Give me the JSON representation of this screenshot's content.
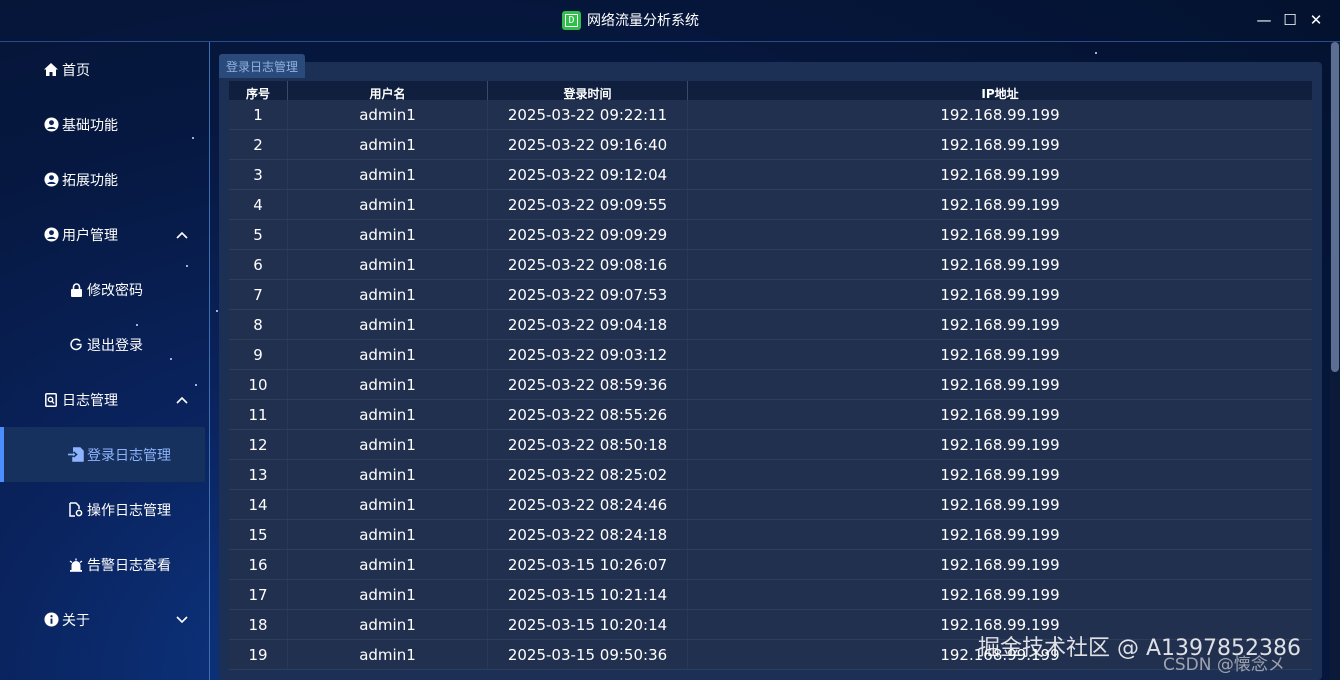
{
  "window": {
    "title": "网络流量分析系统",
    "minimize": "—",
    "maximize": "☐",
    "close": "✕"
  },
  "sidebar": {
    "items": [
      {
        "label": "首页",
        "icon": "home-icon"
      },
      {
        "label": "基础功能",
        "icon": "user-circle-icon"
      },
      {
        "label": "拓展功能",
        "icon": "user-circle-icon"
      },
      {
        "label": "用户管理",
        "icon": "user-circle-icon"
      },
      {
        "label": "修改密码",
        "icon": "lock-icon"
      },
      {
        "label": "退出登录",
        "icon": "logout-icon"
      },
      {
        "label": "日志管理",
        "icon": "log-icon"
      },
      {
        "label": "登录日志管理",
        "icon": "login-file-icon"
      },
      {
        "label": "操作日志管理",
        "icon": "operation-file-icon"
      },
      {
        "label": "告警日志查看",
        "icon": "alarm-icon"
      },
      {
        "label": "关于",
        "icon": "info-icon"
      }
    ]
  },
  "tab": {
    "label": "登录日志管理"
  },
  "table": {
    "headers": [
      "序号",
      "用户名",
      "登录时间",
      "IP地址"
    ],
    "rows": [
      [
        "1",
        "admin1",
        "2025-03-22 09:22:11",
        "192.168.99.199"
      ],
      [
        "2",
        "admin1",
        "2025-03-22 09:16:40",
        "192.168.99.199"
      ],
      [
        "3",
        "admin1",
        "2025-03-22 09:12:04",
        "192.168.99.199"
      ],
      [
        "4",
        "admin1",
        "2025-03-22 09:09:55",
        "192.168.99.199"
      ],
      [
        "5",
        "admin1",
        "2025-03-22 09:09:29",
        "192.168.99.199"
      ],
      [
        "6",
        "admin1",
        "2025-03-22 09:08:16",
        "192.168.99.199"
      ],
      [
        "7",
        "admin1",
        "2025-03-22 09:07:53",
        "192.168.99.199"
      ],
      [
        "8",
        "admin1",
        "2025-03-22 09:04:18",
        "192.168.99.199"
      ],
      [
        "9",
        "admin1",
        "2025-03-22 09:03:12",
        "192.168.99.199"
      ],
      [
        "10",
        "admin1",
        "2025-03-22 08:59:36",
        "192.168.99.199"
      ],
      [
        "11",
        "admin1",
        "2025-03-22 08:55:26",
        "192.168.99.199"
      ],
      [
        "12",
        "admin1",
        "2025-03-22 08:50:18",
        "192.168.99.199"
      ],
      [
        "13",
        "admin1",
        "2025-03-22 08:25:02",
        "192.168.99.199"
      ],
      [
        "14",
        "admin1",
        "2025-03-22 08:24:46",
        "192.168.99.199"
      ],
      [
        "15",
        "admin1",
        "2025-03-22 08:24:18",
        "192.168.99.199"
      ],
      [
        "16",
        "admin1",
        "2025-03-15 10:26:07",
        "192.168.99.199"
      ],
      [
        "17",
        "admin1",
        "2025-03-15 10:21:14",
        "192.168.99.199"
      ],
      [
        "18",
        "admin1",
        "2025-03-15 10:20:14",
        "192.168.99.199"
      ],
      [
        "19",
        "admin1",
        "2025-03-15 09:50:36",
        "192.168.99.199"
      ]
    ]
  },
  "watermark": {
    "line1": "掘金技术社区 @ A1397852386",
    "line2": "CSDN @懐念メ"
  },
  "colors": {
    "accent": "#4c8dff",
    "active_text": "#8fb4ff",
    "panel": "#1c2f55"
  }
}
